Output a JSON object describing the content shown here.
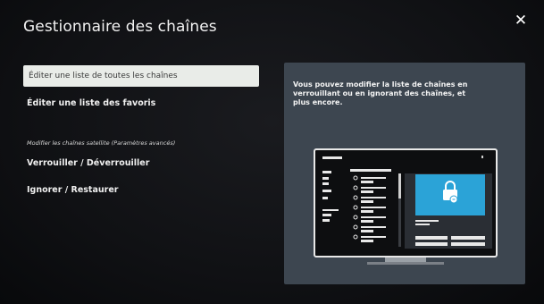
{
  "header": {
    "title": "Gestionnaire des chaînes"
  },
  "close": {
    "icon": "close-icon",
    "glyph": "✕"
  },
  "menu": {
    "items": [
      {
        "label": "Éditer une liste de toutes les chaînes",
        "selected": true
      },
      {
        "label": "Éditer une liste des favoris",
        "selected": false
      }
    ],
    "section_header": "Modifier les chaînes satellite (Paramètres avancés)",
    "satellite_items": [
      {
        "label": "Verrouiller / Déverrouiller"
      },
      {
        "label": "Ignorer / Restaurer"
      }
    ]
  },
  "info_panel": {
    "text": "Vous pouvez modifier la liste de chaînes en verrouillant ou en ignorant des chaînes, et plus encore.",
    "illustration_icon": "lock-icon"
  },
  "colors": {
    "selected_bg": "#e9ece8",
    "panel_bg": "#3d4650",
    "accent_blue": "#2ba3d7"
  }
}
